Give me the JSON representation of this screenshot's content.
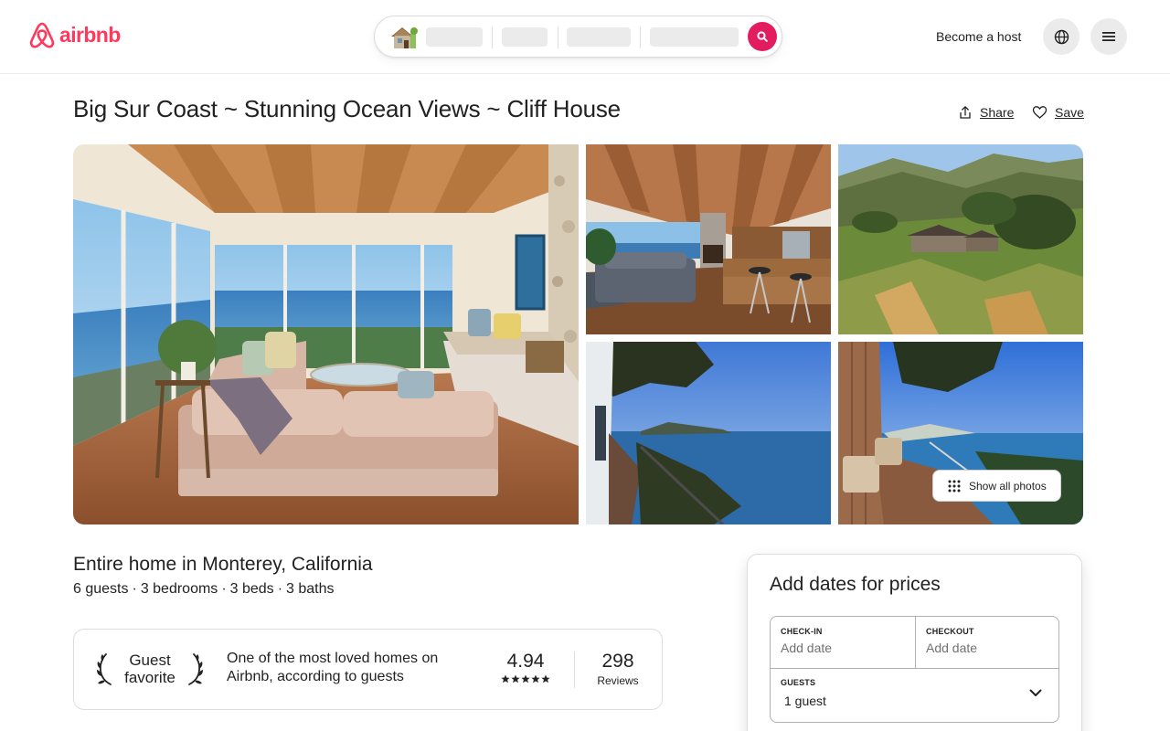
{
  "header": {
    "brand": "airbnb",
    "become_host": "Become a host",
    "language_icon": "globe-icon",
    "menu_icon": "hamburger-menu-icon",
    "search_icon": "search-icon"
  },
  "listing": {
    "title": "Big Sur Coast ~ Stunning Ocean Views ~ Cliff House",
    "share_label": "Share",
    "save_label": "Save",
    "show_all_photos": "Show all photos",
    "subtitle": "Entire home in Monterey, California",
    "facts": [
      "6 guests",
      "3 bedrooms",
      "3 beds",
      "3 baths"
    ]
  },
  "guest_favorite": {
    "badge_line1": "Guest",
    "badge_line2": "favorite",
    "description": "One of the most loved homes on Airbnb, according to guests",
    "rating": "4.94",
    "stars": 5,
    "review_count": "298",
    "reviews_label": "Reviews"
  },
  "booking": {
    "heading": "Add dates for prices",
    "checkin_label": "CHECK-IN",
    "checkin_value": "Add date",
    "checkout_label": "CHECKOUT",
    "checkout_value": "Add date",
    "guests_label": "GUESTS",
    "guests_value": "1 guest"
  },
  "colors": {
    "brand": "#ff385c",
    "search_button": "#e31c5f",
    "text": "#222222",
    "muted": "#717171",
    "border": "#dddddd"
  }
}
